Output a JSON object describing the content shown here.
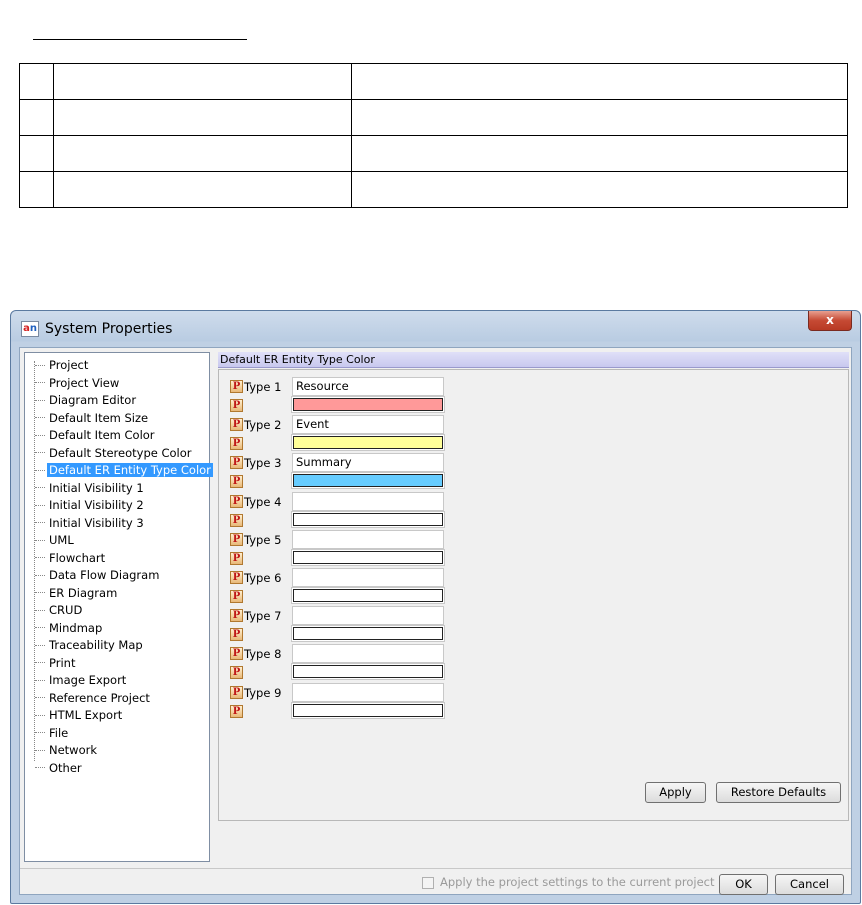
{
  "window": {
    "title": "System Properties",
    "close_label": "x"
  },
  "tree": {
    "items": [
      {
        "label": "Project"
      },
      {
        "label": "Project View"
      },
      {
        "label": "Diagram Editor"
      },
      {
        "label": "Default Item Size"
      },
      {
        "label": "Default Item Color"
      },
      {
        "label": "Default Stereotype Color"
      },
      {
        "label": "Default ER Entity Type Color",
        "selected": true
      },
      {
        "label": "Initial Visibility 1"
      },
      {
        "label": "Initial Visibility 2"
      },
      {
        "label": "Initial Visibility 3"
      },
      {
        "label": "UML"
      },
      {
        "label": "Flowchart"
      },
      {
        "label": "Data Flow Diagram"
      },
      {
        "label": "ER Diagram"
      },
      {
        "label": "CRUD"
      },
      {
        "label": "Mindmap"
      },
      {
        "label": "Traceability Map"
      },
      {
        "label": "Print"
      },
      {
        "label": "Image Export"
      },
      {
        "label": "Reference Project"
      },
      {
        "label": "HTML Export"
      },
      {
        "label": "File"
      },
      {
        "label": "Network"
      },
      {
        "label": "Other"
      }
    ]
  },
  "panel": {
    "header": "Default ER Entity Type Color",
    "p_icon_glyph": "P",
    "types": [
      {
        "label": "Type 1",
        "value": "Resource",
        "color": "#ff9999"
      },
      {
        "label": "Type 2",
        "value": "Event",
        "color": "#ffff99"
      },
      {
        "label": "Type 3",
        "value": "Summary",
        "color": "#66ccff"
      },
      {
        "label": "Type 4",
        "value": "",
        "color": "#ffffff"
      },
      {
        "label": "Type 5",
        "value": "",
        "color": "#ffffff"
      },
      {
        "label": "Type 6",
        "value": "",
        "color": "#ffffff"
      },
      {
        "label": "Type 7",
        "value": "",
        "color": "#ffffff"
      },
      {
        "label": "Type 8",
        "value": "",
        "color": "#ffffff"
      },
      {
        "label": "Type 9",
        "value": "",
        "color": "#ffffff"
      }
    ]
  },
  "buttons": {
    "apply": "Apply",
    "restore_defaults": "Restore Defaults",
    "ok": "OK",
    "cancel": "Cancel"
  },
  "bottom": {
    "checkbox_label": "Apply the project settings to the current project",
    "checkbox_checked": false
  }
}
